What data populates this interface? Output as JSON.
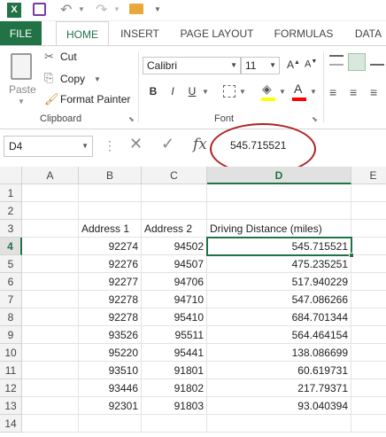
{
  "titlebar": {
    "icons": [
      "excel-icon",
      "save-icon",
      "undo-icon",
      "redo-icon",
      "open-folder-icon",
      "customize-icon"
    ]
  },
  "tabs": [
    {
      "label": "FILE"
    },
    {
      "label": "HOME"
    },
    {
      "label": "INSERT"
    },
    {
      "label": "PAGE LAYOUT"
    },
    {
      "label": "FORMULAS"
    },
    {
      "label": "DATA"
    }
  ],
  "clipboard": {
    "paste": "Paste",
    "cut": "Cut",
    "copy": "Copy",
    "format_painter": "Format Painter",
    "group": "Clipboard"
  },
  "font": {
    "name": "Calibri",
    "size": "11",
    "bold": "B",
    "italic": "I",
    "underline": "U",
    "group": "Font",
    "highlight_color": "#ffff00",
    "text_color": "#ff0000"
  },
  "formula_bar": {
    "name_box": "D4",
    "fx": "fx",
    "value": "545.715521"
  },
  "columns": [
    "A",
    "B",
    "C",
    "D",
    "E"
  ],
  "rows": [
    "1",
    "2",
    "3",
    "4",
    "5",
    "6",
    "7",
    "8",
    "9",
    "10",
    "11",
    "12",
    "13",
    "14"
  ],
  "sheet": {
    "headers": {
      "b": "Address 1",
      "c": "Address 2",
      "d": "Driving Distance (miles)"
    },
    "data": [
      {
        "b": "92274",
        "c": "94502",
        "d": "545.715521"
      },
      {
        "b": "92276",
        "c": "94507",
        "d": "475.235251"
      },
      {
        "b": "92277",
        "c": "94706",
        "d": "517.940229"
      },
      {
        "b": "92278",
        "c": "94710",
        "d": "547.086266"
      },
      {
        "b": "92278",
        "c": "95410",
        "d": "684.701344"
      },
      {
        "b": "93526",
        "c": "95511",
        "d": "564.464154"
      },
      {
        "b": "95220",
        "c": "95441",
        "d": "138.086699"
      },
      {
        "b": "93510",
        "c": "91801",
        "d": "60.619731"
      },
      {
        "b": "93446",
        "c": "91802",
        "d": "217.79371"
      },
      {
        "b": "92301",
        "c": "91803",
        "d": "93.040394"
      }
    ]
  },
  "colors": {
    "accent": "#217346",
    "annotation": "#b22222"
  }
}
